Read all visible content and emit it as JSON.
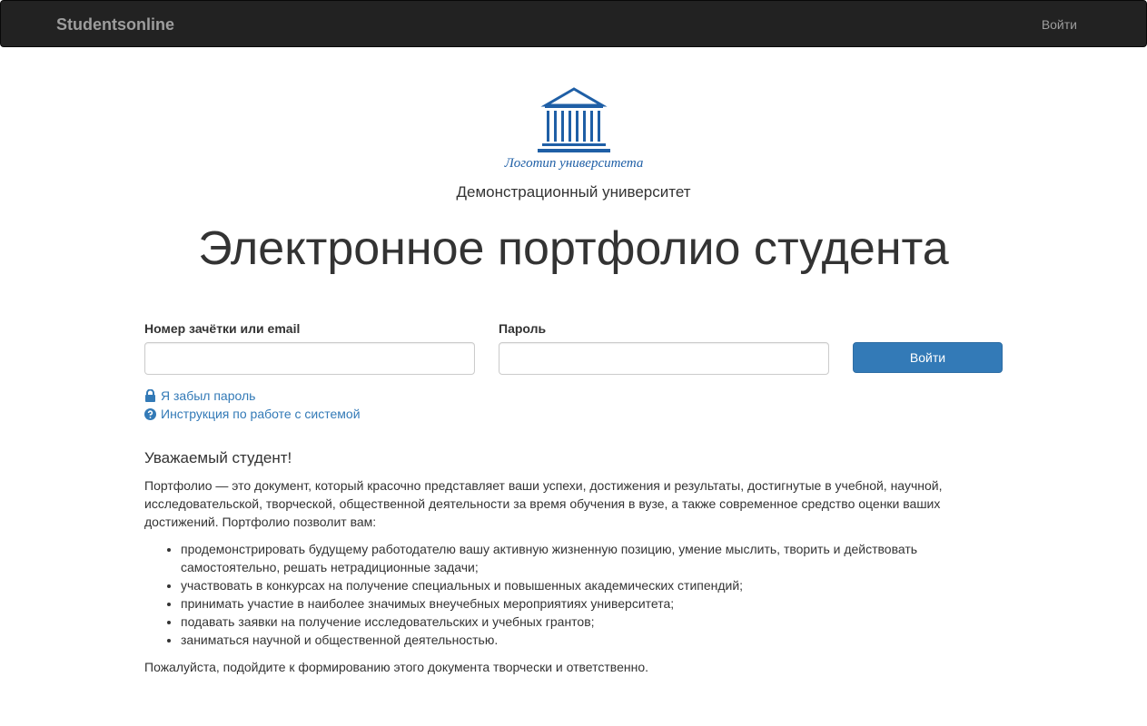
{
  "navbar": {
    "brand": "Studentsonline",
    "login_link": "Войти"
  },
  "logo": {
    "caption": "Логотип университета",
    "color": "#1f5fa6"
  },
  "university_name": "Демонстрационный университет",
  "page_title": "Электронное портфолио студента",
  "login_form": {
    "login_label": "Номер зачётки или email",
    "login_value": "",
    "password_label": "Пароль",
    "password_value": "",
    "submit_label": "Войти"
  },
  "links": {
    "forgot_password": "Я забыл пароль",
    "forgot_icon": "lock-icon",
    "instructions": "Инструкция по работе с системой",
    "instructions_icon": "question-circle-icon"
  },
  "content": {
    "greeting": "Уважаемый студент!",
    "intro": "Портфолио — это документ, который красочно представляет ваши успехи, достижения и результаты, достигнутые в учебной, научной, исследовательской, творческой, общественной деятельности за время обучения в вузе, а также современное средство оценки ваших достижений. Портфолио позволит вам:",
    "bullets": [
      "продемонстрировать будущему работодателю вашу активную жизненную позицию, умение мыслить, творить и действовать самостоятельно, решать нетрадиционные задачи;",
      "участвовать в конкурсах на получение специальных и повышенных академических стипендий;",
      "принимать участие в наиболее значимых внеучебных мероприятиях университета;",
      "подавать заявки на получение исследовательских и учебных грантов;",
      "заниматься научной и общественной деятельностью."
    ],
    "outro": "Пожалуйста, подойдите к формированию этого документа творчески и ответственно."
  },
  "colors": {
    "navbar_bg": "#222222",
    "accent": "#337ab7"
  }
}
